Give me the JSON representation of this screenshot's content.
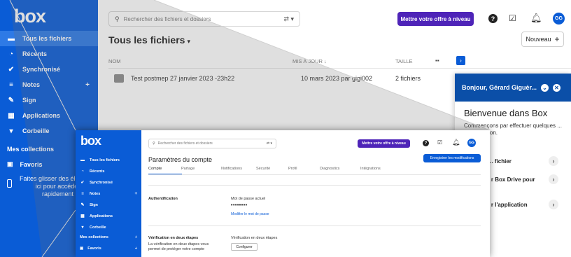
{
  "background": {
    "logo": "box",
    "nav": [
      {
        "label": "Tous les fichiers",
        "icon": "folder-icon",
        "active": true
      },
      {
        "label": "Récents",
        "icon": "clock-icon"
      },
      {
        "label": "Synchronisé",
        "icon": "check-circle-icon"
      },
      {
        "label": "Notes",
        "icon": "notes-icon",
        "plus": "+"
      },
      {
        "label": "Sign",
        "icon": "sign-icon"
      },
      {
        "label": "Applications",
        "icon": "grid-icon"
      },
      {
        "label": "Corbeille",
        "icon": "trash-icon"
      }
    ],
    "collections_title": "Mes collections",
    "favorites": "Favoris",
    "drag_hint": "Faites glisser des éléments ici pour accéder rapidement",
    "search_placeholder": "Rechercher des fichiers et dossiers",
    "upgrade": "Mettre votre offre à niveau",
    "avatar": "GG",
    "help": "?",
    "page_title": "Tous les fichiers",
    "title_caret": "▾",
    "nouveau": "Nouveau",
    "nouveau_plus": "+",
    "columns": {
      "name": "NOM",
      "modified": "MIS À JOUR ↓",
      "size": "TAILLE"
    },
    "rows": [
      {
        "name": "Test postmep 27 janvier 2023 -23h22",
        "modified": "10 mars 2023 par gigi002",
        "size": "2 fichiers"
      }
    ],
    "welcome": {
      "greeting": "Bonjour, Gérard Giguèr...",
      "title": "Bienvenue dans Box",
      "subtitle": "Commençons par effectuer quelques ... configuration.",
      "items": [
        "... fichier",
        "... r Box Drive pour",
        "... r l'application"
      ]
    }
  },
  "inset": {
    "logo": "box",
    "nav": [
      {
        "label": "Tous les fichiers",
        "icon": "folder-icon"
      },
      {
        "label": "Récents",
        "icon": "clock-icon"
      },
      {
        "label": "Synchronisé",
        "icon": "check-circle-icon"
      },
      {
        "label": "Notes",
        "icon": "notes-icon",
        "plus": "+"
      },
      {
        "label": "Sign",
        "icon": "sign-icon"
      },
      {
        "label": "Applications",
        "icon": "grid-icon"
      },
      {
        "label": "Corbeille",
        "icon": "trash-icon"
      }
    ],
    "collections_title": "Mes collections",
    "favorites": "Favoris",
    "plus": "+",
    "search_placeholder": "Rechercher des fichiers et dossiers",
    "upgrade": "Mettre votre offre à niveau",
    "avatar": "GG",
    "help": "?",
    "page_title": "Paramètres du compte",
    "save": "Enregistrer les modifications",
    "tabs": [
      "Compte",
      "Partage",
      "Notifications",
      "Sécurité",
      "Profil",
      "Diagnostics",
      "Intégrations"
    ],
    "auth_title": "Authentification",
    "pwd_label": "Mot de passe actuel",
    "pwd_value": "••••••••",
    "pwd_link": "Modifier le mot de passe",
    "twofa_title": "Vérification en deux étapes",
    "twofa_desc": "La vérification en deux étapes vous permet de protéger votre compte",
    "twofa_label": "Vérification en deux étapes",
    "configure": "Configurer"
  },
  "colors": {
    "brand_blue": "#0a5cd6",
    "upgrade_purple": "#4e24b8",
    "welcome_header": "#0b4fa8"
  }
}
